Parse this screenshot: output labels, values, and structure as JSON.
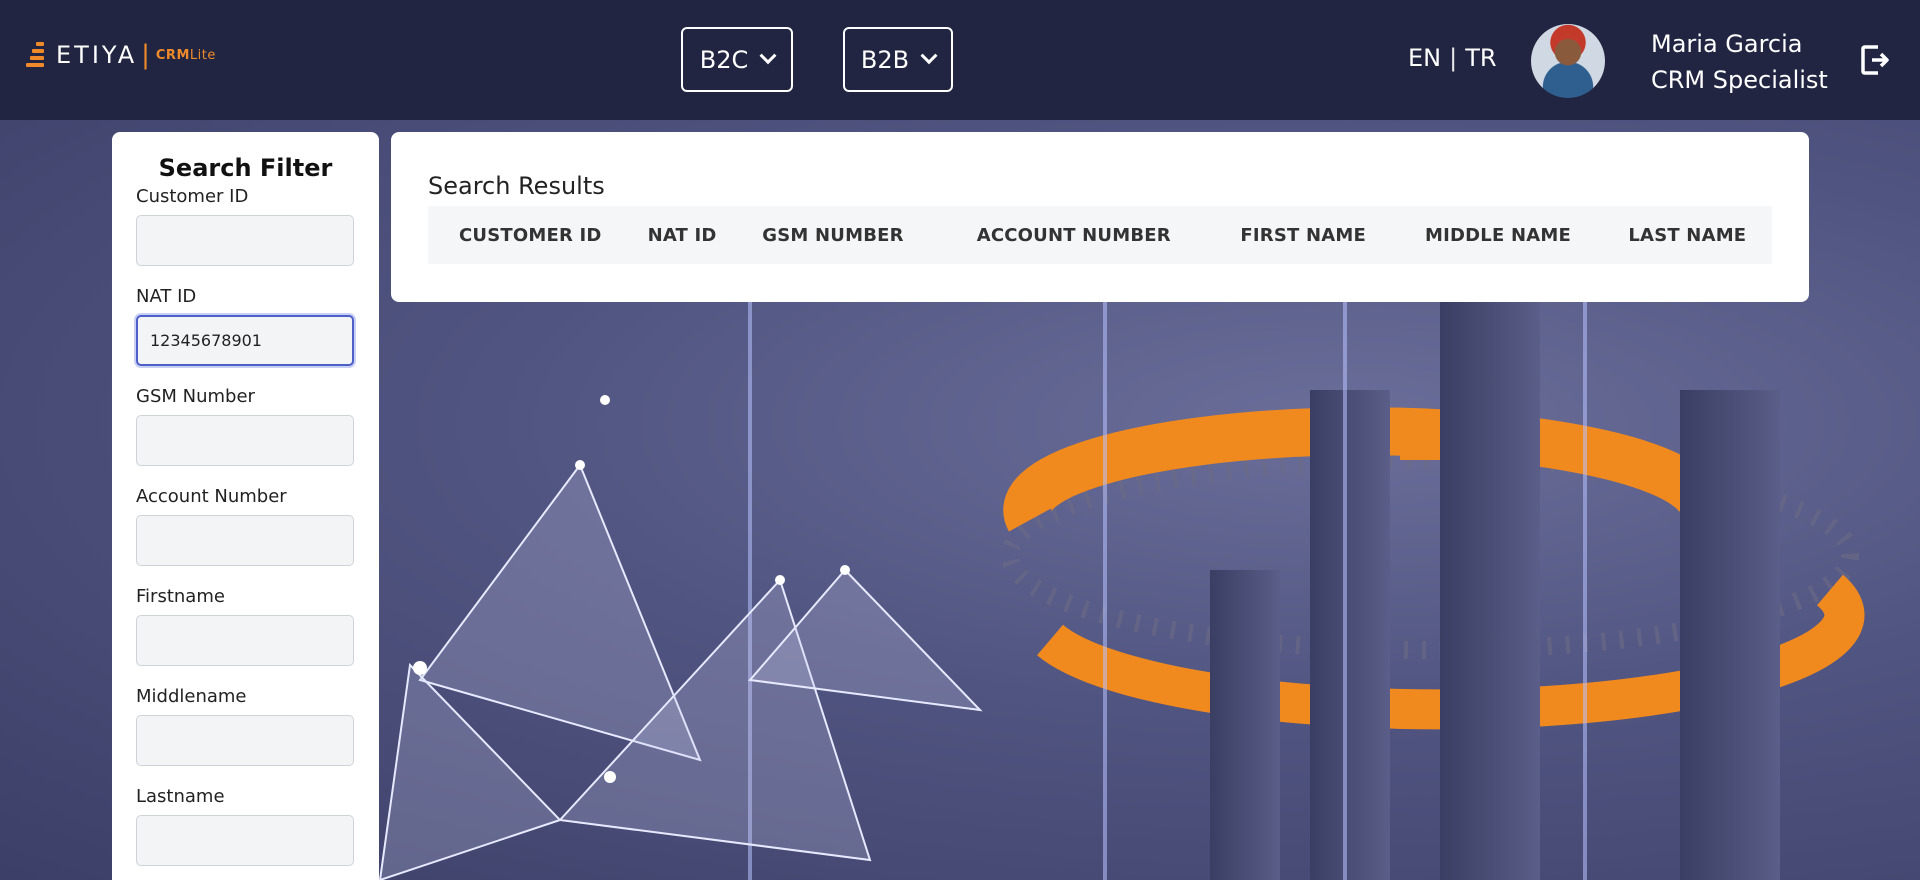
{
  "header": {
    "logo": {
      "brand": "ETIYA",
      "separator": "|",
      "product_main": "CRM",
      "product_sub": "Lite"
    },
    "segments": [
      {
        "label": "B2C"
      },
      {
        "label": "B2B"
      }
    ],
    "language": {
      "en": "EN",
      "separator": "|",
      "tr": "TR"
    },
    "user": {
      "name": "Maria Garcia",
      "role": "CRM Specialist"
    },
    "icons": {
      "dropdown": "chevron-down-icon",
      "logout": "logout-icon"
    }
  },
  "filter": {
    "title": "Search Filter",
    "fields": [
      {
        "label": "Customer ID",
        "value": ""
      },
      {
        "label": "NAT ID",
        "value": "12345678901"
      },
      {
        "label": "GSM Number",
        "value": ""
      },
      {
        "label": "Account Number",
        "value": ""
      },
      {
        "label": "Firstname",
        "value": ""
      },
      {
        "label": "Middlename",
        "value": ""
      },
      {
        "label": "Lastname",
        "value": ""
      }
    ]
  },
  "results": {
    "title": "Search Results",
    "columns": [
      "CUSTOMER ID",
      "NAT ID",
      "GSM NUMBER",
      "ACCOUNT NUMBER",
      "FIRST NAME",
      "MIDDLE NAME",
      "LAST NAME"
    ],
    "rows": []
  },
  "colors": {
    "header_bg": "#212541",
    "accent_orange": "#ef8a2a",
    "focus_border": "#4e5fc7"
  }
}
